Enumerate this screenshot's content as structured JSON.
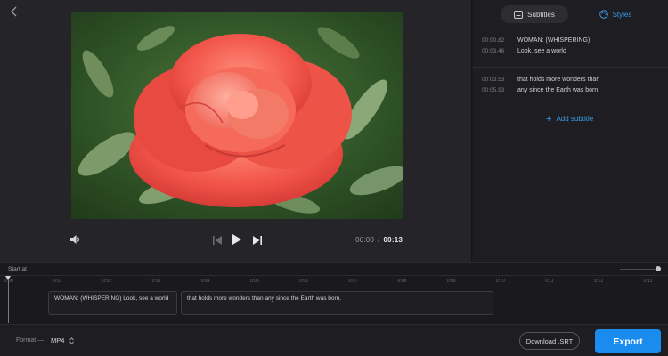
{
  "preview": {
    "back_icon": "chevron-left-icon",
    "video_frame": "red rose",
    "controls": {
      "volume_icon": "volume-icon",
      "prev_icon": "skip-previous-icon",
      "play_icon": "play-icon",
      "next_icon": "skip-next-icon",
      "current_time": "00:00",
      "separator": "/",
      "duration": "00:13"
    }
  },
  "sidepanel": {
    "tabs": [
      {
        "label": "Subtitles",
        "icon": "subtitles-icon",
        "active": true
      },
      {
        "label": "Styles",
        "icon": "palette-icon",
        "active": false
      }
    ],
    "subtitles": [
      {
        "start": "00:00.82",
        "end": "00:03.46",
        "text_line1": "WOMAN: (WHISPERING)",
        "text_line2": "Look, see a world"
      },
      {
        "start": "00:03.53",
        "end": "00:05.93",
        "text_line1": "that holds more wonders than",
        "text_line2": "any since the Earth was born."
      }
    ],
    "add_label": "Add subtitle",
    "accent": "#3a9be8"
  },
  "timeline": {
    "start_label": "Start at",
    "ticks": [
      "0:00",
      "0:01",
      "0:02",
      "0:03",
      "0:04",
      "0:05",
      "0:06",
      "0:07",
      "0:08",
      "0:09",
      "0:10",
      "0:11",
      "0:12",
      "0:13"
    ],
    "clips": [
      {
        "text": "WOMAN: (WHISPERING) Look, see a world"
      },
      {
        "text": "that holds more wonders than any since the Earth was born."
      }
    ],
    "zoom_level": 1.0
  },
  "bottom": {
    "format_label": "Format —",
    "format_value": "MP4",
    "download_label": "Download .SRT",
    "export_label": "Export",
    "export_color": "#1a8cf0"
  }
}
